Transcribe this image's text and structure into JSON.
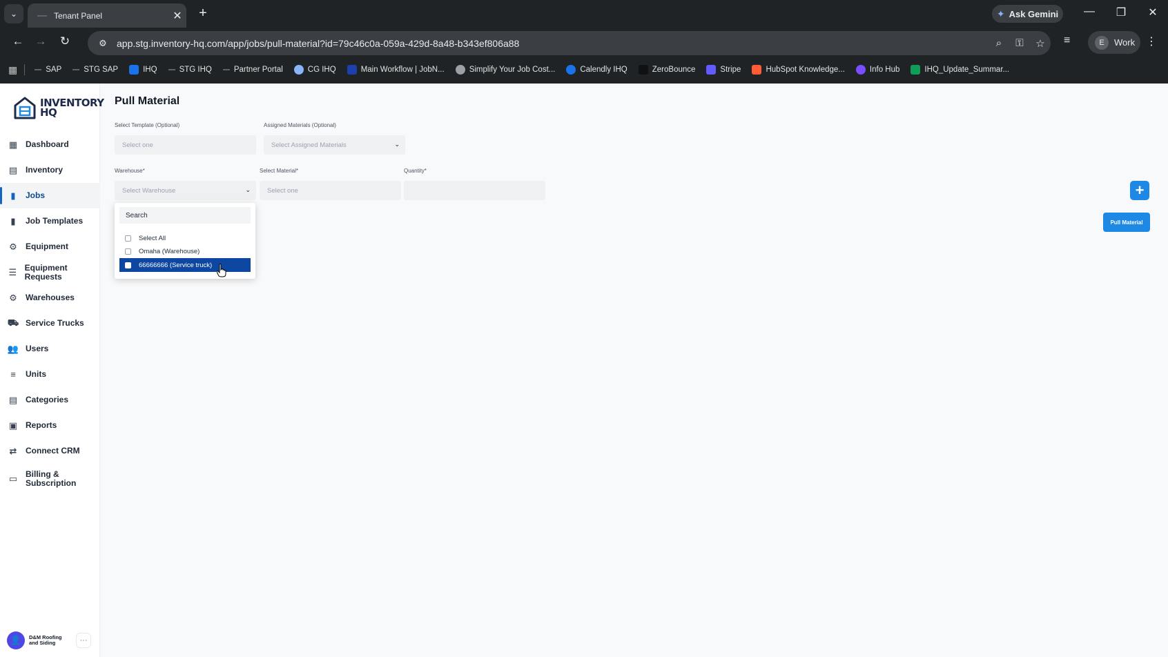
{
  "browser": {
    "tab_title": "Tenant Panel",
    "url": "app.stg.inventory-hq.com/app/jobs/pull-material?id=79c46c0a-059a-429d-8a48-b343ef806a88",
    "gemini_label": "Ask Gemini",
    "profile_initial": "E",
    "profile_name": "Work",
    "bookmarks": [
      {
        "label": "SAP",
        "icon": "dash-icon",
        "color": "#5f6368"
      },
      {
        "label": "STG SAP",
        "icon": "dash-icon",
        "color": "#5f6368"
      },
      {
        "label": "IHQ",
        "icon": "house-icon",
        "color": "#1a73e8"
      },
      {
        "label": "STG IHQ",
        "icon": "dash-icon",
        "color": "#5f6368"
      },
      {
        "label": "Partner Portal",
        "icon": "dash-icon",
        "color": "#5f6368"
      },
      {
        "label": "CG IHQ",
        "icon": "circle-icon",
        "color": "#8ab4f8"
      },
      {
        "label": "Main Workflow | JobN...",
        "icon": "jobnimbus-icon",
        "color": "#1e40af"
      },
      {
        "label": "Simplify Your Job Cost...",
        "icon": "globe-icon",
        "color": "#9aa0a6"
      },
      {
        "label": "Calendly IHQ",
        "icon": "calendly-icon",
        "color": "#1a73e8"
      },
      {
        "label": "ZeroBounce",
        "icon": "zerobounce-icon",
        "color": "#111111"
      },
      {
        "label": "Stripe",
        "icon": "stripe-icon",
        "color": "#635bff"
      },
      {
        "label": "HubSpot Knowledge...",
        "icon": "hubspot-icon",
        "color": "#ff5c35"
      },
      {
        "label": "Info Hub",
        "icon": "info-hub-icon",
        "color": "#7c4dff"
      },
      {
        "label": "IHQ_Update_Summar...",
        "icon": "sheets-icon",
        "color": "#0f9d58"
      }
    ]
  },
  "app": {
    "logo_line1": "INVENTORY",
    "logo_line2": "HQ",
    "nav": [
      {
        "label": "Dashboard",
        "icon": "dashboard-icon",
        "glyph": "▦",
        "active": false
      },
      {
        "label": "Inventory",
        "icon": "inventory-icon",
        "glyph": "▤",
        "active": false
      },
      {
        "label": "Jobs",
        "icon": "jobs-icon",
        "glyph": "▮",
        "active": true
      },
      {
        "label": "Job Templates",
        "icon": "job-templates-icon",
        "glyph": "▮",
        "active": false
      },
      {
        "label": "Equipment",
        "icon": "equipment-icon",
        "glyph": "⚙",
        "active": false
      },
      {
        "label": "Equipment Requests",
        "icon": "equipment-requests-icon",
        "glyph": "☰",
        "active": false
      },
      {
        "label": "Warehouses",
        "icon": "warehouses-icon",
        "glyph": "⚙",
        "active": false
      },
      {
        "label": "Service Trucks",
        "icon": "truck-icon",
        "glyph": "⛟",
        "active": false
      },
      {
        "label": "Users",
        "icon": "users-icon",
        "glyph": "👥",
        "active": false
      },
      {
        "label": "Units",
        "icon": "units-icon",
        "glyph": "≡",
        "active": false
      },
      {
        "label": "Categories",
        "icon": "categories-icon",
        "glyph": "▤",
        "active": false
      },
      {
        "label": "Reports",
        "icon": "reports-icon",
        "glyph": "▣",
        "active": false
      },
      {
        "label": "Connect CRM",
        "icon": "connect-crm-icon",
        "glyph": "⇄",
        "active": false
      },
      {
        "label": "Billing &\nSubscription",
        "icon": "billing-icon",
        "glyph": "▭",
        "active": false
      }
    ],
    "org_name": "D&M Roofing and Siding",
    "org_more": "···"
  },
  "form": {
    "title": "Pull Material",
    "template_label": "Select Template (Optional)",
    "template_placeholder": "Select one",
    "assigned_label": "Assigned Materials (Optional)",
    "assigned_placeholder": "Select Assigned Materials",
    "warehouse_label": "Warehouse*",
    "warehouse_placeholder": "Select Warehouse",
    "material_label": "Select Material*",
    "material_placeholder": "Select one",
    "quantity_label": "Quantity*",
    "quantity_value": "",
    "add_button": "+",
    "pull_button": "Pull Material"
  },
  "dropdown": {
    "search_placeholder": "Search",
    "options": [
      {
        "label": "Select All",
        "highlighted": false
      },
      {
        "label": "Omaha (Warehouse)",
        "highlighted": false
      },
      {
        "label": "66666666 (Service truck)",
        "highlighted": true
      }
    ]
  },
  "colors": {
    "accent": "#1e88e5",
    "highlight": "#0d47a1",
    "chrome_bg": "#1f2326"
  }
}
